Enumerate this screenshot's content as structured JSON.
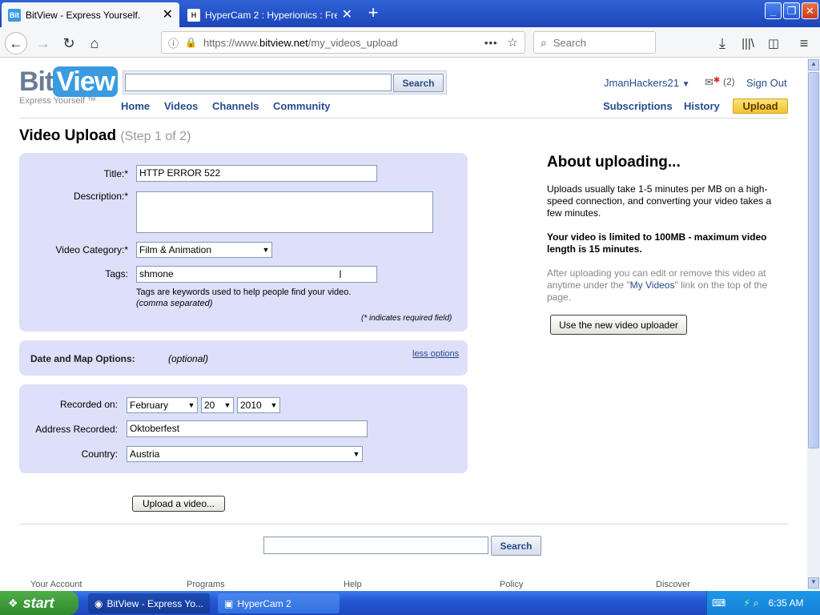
{
  "browser": {
    "tabs": [
      {
        "title": "BitView - Express Yourself.",
        "icon_text": "Bit"
      },
      {
        "title": "HyperCam 2 : Hyperionics : Free D",
        "icon_text": "H"
      }
    ],
    "url_prefix": "https://www.",
    "url_domain": "bitview.net",
    "url_path": "/my_videos_upload",
    "search_placeholder": "Search"
  },
  "site": {
    "logo_bit": "Bit",
    "logo_view": "View",
    "tagline": "Express Yourself ™",
    "header_search_button": "Search",
    "nav": [
      "Home",
      "Videos",
      "Channels",
      "Community"
    ],
    "username": "JmanHackers21",
    "message_count": "(2)",
    "sign_out": "Sign Out",
    "subscriptions": "Subscriptions",
    "history": "History",
    "upload": "Upload"
  },
  "upload": {
    "heading": "Video Upload",
    "step": "(Step 1 of 2)",
    "title_label": "Title:*",
    "title_value": "HTTP ERROR 522",
    "description_label": "Description:*",
    "description_value": "",
    "category_label": "Video Category:*",
    "category_value": "Film & Animation",
    "tags_label": "Tags:",
    "tags_value": "shmone",
    "tags_help": "Tags are keywords used to help people find your video.",
    "tags_help2": "(comma separated)",
    "required_note": "(* indicates required field)",
    "date_map_label": "Date and Map Options:",
    "optional": "(optional)",
    "less_options": "less options",
    "recorded_on_label": "Recorded on:",
    "month": "February",
    "day": "20",
    "year": "2010",
    "address_label": "Address Recorded:",
    "address_value": "Oktoberfest",
    "country_label": "Country:",
    "country_value": "Austria",
    "upload_button": "Upload a video..."
  },
  "about": {
    "heading": "About uploading...",
    "para1": "Uploads usually take 1-5 minutes per MB on a high-speed connection, and converting your video takes a few minutes.",
    "para2": "Your video is limited to 100MB - maximum video length is 15 minutes.",
    "para3_a": "After uploading you can edit or remove this video at anytime under the \"",
    "para3_link": "My Videos",
    "para3_b": "\" link on the top of the page.",
    "new_uploader_button": "Use the new video uploader"
  },
  "footer": {
    "search_button": "Search",
    "links": [
      "Your Account",
      "Programs",
      "Help",
      "Policy",
      "Discover"
    ]
  },
  "taskbar": {
    "start": "start",
    "items": [
      "BitView - Express Yo...",
      "HyperCam 2"
    ],
    "time": "6:35 AM"
  },
  "colors": {
    "panel": "#dedff8",
    "link": "#274b8d",
    "upload_button": "#f7d34a",
    "xp_blue": "#2457d3"
  }
}
